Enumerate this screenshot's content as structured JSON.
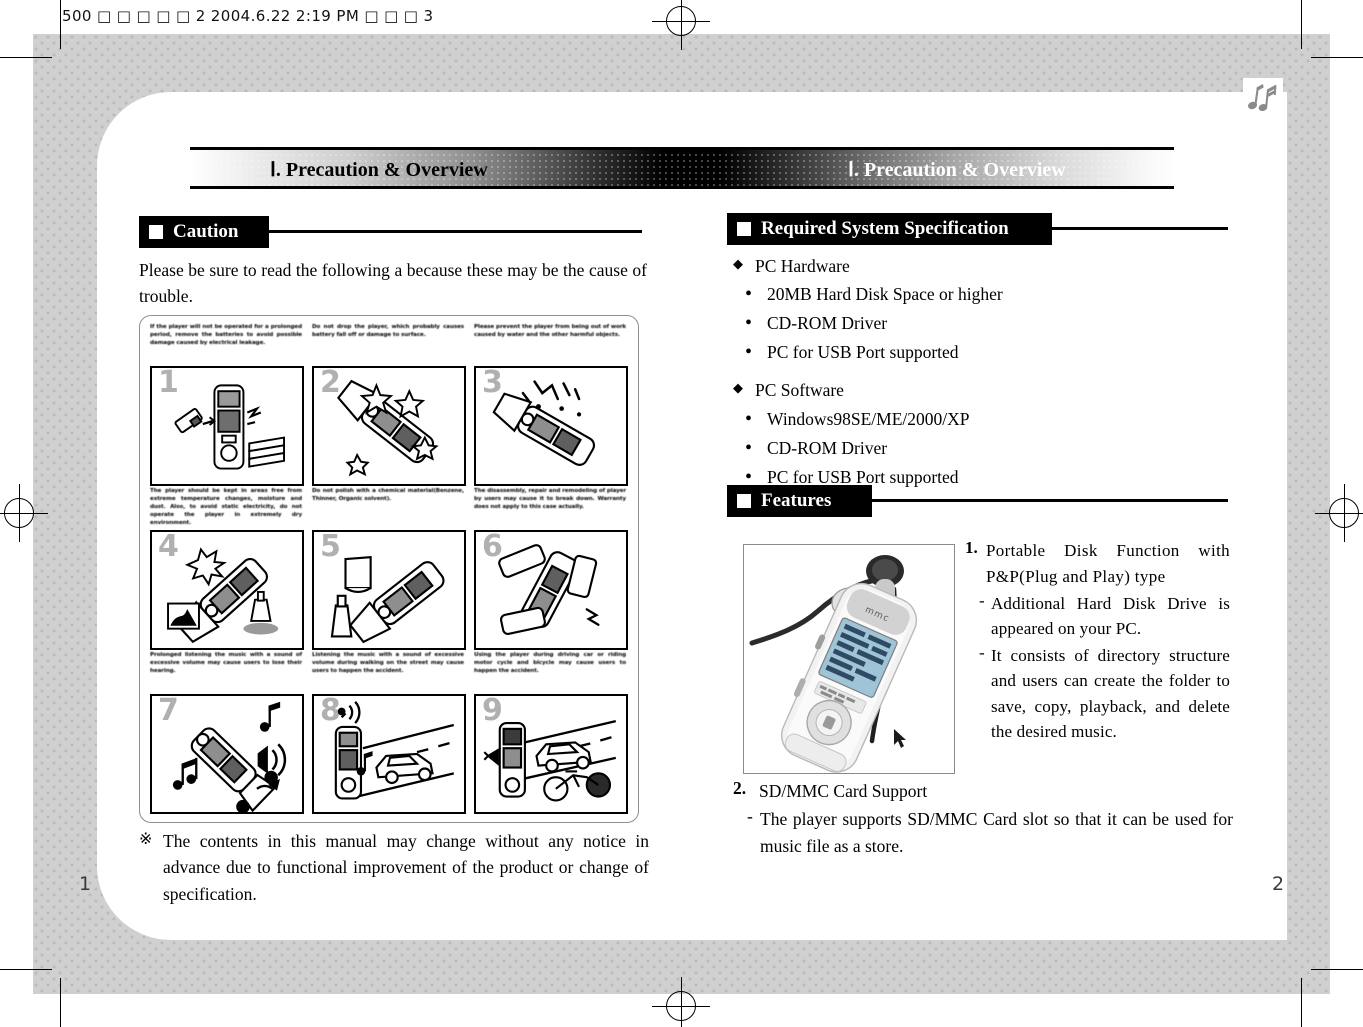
{
  "print_header": {
    "text": "500 □ □  □ □ □ 2  2004.6.22 2:19 PM  □ □ □  3"
  },
  "logo": {
    "name": "music-notes-logo"
  },
  "banner": {
    "left_title": "Ⅰ. Precaution & Overview",
    "right_title": "Ⅰ. Precaution & Overview"
  },
  "left_page": {
    "number": "1",
    "caution": {
      "heading": "Caution",
      "intro": "Please be sure to read the following a because these may be the cause of trouble.",
      "cells": [
        {
          "number": "1",
          "caption": "If the player will not be operated for a prolonged period, remove the batteries to avoid possible damage caused by electrical leakage.",
          "art": "player-battery-removal"
        },
        {
          "number": "2",
          "caption": "Do not drop the player, which probably causes battery fall off or damage to surface.",
          "art": "player-dropped-impact"
        },
        {
          "number": "3",
          "caption": "Please prevent the player from being out of work caused by water and the other harmful objects.",
          "art": "player-water-splash"
        },
        {
          "number": "4",
          "caption": "The player should be kept in areas free from extreme temperature changes, moisture and dust. Also, to avoid static electricity, do not operate the player in extremely dry environment.",
          "art": "player-heat-dust-moisture"
        },
        {
          "number": "5",
          "caption": "Do not polish with a chemical material(Benzene, Thinner, Organic solvent).",
          "art": "player-chemical-solvent"
        },
        {
          "number": "6",
          "caption": "The disassembly, repair and remodeling of player by users may cause it to break down. Warranty does not apply to this case actually.",
          "art": "player-disassembly"
        },
        {
          "number": "7",
          "caption": "Prolonged listening the music with a sound of excessive volume may cause users to lose their hearing.",
          "art": "player-loud-volume-hearing"
        },
        {
          "number": "8",
          "caption": "Listening the music with a sound of excessive volume during walking on the street may cause users to happen the accident.",
          "art": "player-walking-street-car"
        },
        {
          "number": "9",
          "caption": "Using the player during driving car or riding motor cycle and bicycle may cause users to happen the accident.",
          "art": "player-driving-riding"
        }
      ]
    },
    "footnote": {
      "mark": "※",
      "text": "The contents in this manual may change without any notice in advance due to functional improvement of the product or change of specification."
    }
  },
  "right_page": {
    "number": "2",
    "system_spec": {
      "heading": "Required System Specification",
      "groups": [
        {
          "bullet": "◆",
          "label": "PC Hardware",
          "items": [
            {
              "bullet": "•",
              "text": "20MB Hard Disk Space or higher"
            },
            {
              "bullet": "•",
              "text": "CD-ROM Driver"
            },
            {
              "bullet": "•",
              "text": "PC for USB Port supported"
            }
          ]
        },
        {
          "bullet": "◆",
          "label": "PC Software",
          "items": [
            {
              "bullet": "•",
              "text": "Windows98SE/ME/2000/XP"
            },
            {
              "bullet": "•",
              "text": "CD-ROM Driver"
            },
            {
              "bullet": "•",
              "text": "PC for USB Port supported"
            }
          ]
        }
      ]
    },
    "features": {
      "heading": "Features",
      "photo_alt": "mp3-player-with-earphones",
      "item1": {
        "number": "1.",
        "title": "Portable Disk Function with P&P(Plug and Play) type",
        "subs": [
          {
            "dash": "-",
            "text": "Additional Hard Disk Drive is appeared on your PC."
          },
          {
            "dash": "-",
            "text": "It consists of directory structure and users can create the folder to save, copy, playback, and delete the desired music."
          }
        ]
      },
      "item2": {
        "number": "2.",
        "title": "SD/MMC Card Support",
        "subs": [
          {
            "dash": "-",
            "text": "The player supports SD/MMC Card slot so that it can be used for music file as a store."
          }
        ]
      }
    }
  },
  "colors": {
    "ink": "#000000",
    "paper": "#ffffff",
    "gray_field": "#d0d0d0",
    "frame_gray": "#8f8f8f",
    "cell_number": "#b0b0b0"
  }
}
